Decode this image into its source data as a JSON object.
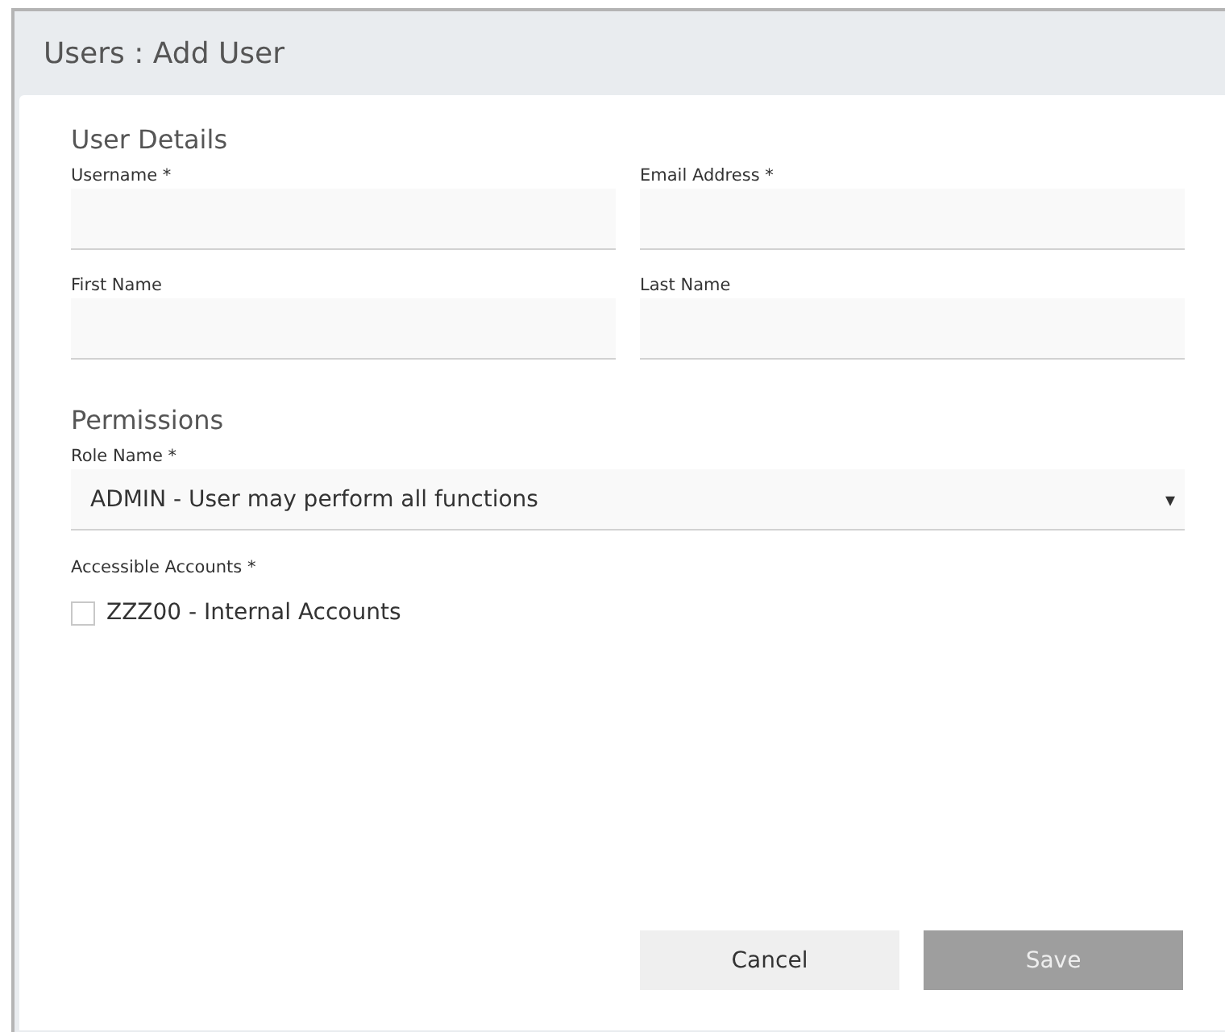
{
  "window": {
    "title": "Users : Add User"
  },
  "sections": [
    {
      "title": "User Details",
      "fields": [
        {
          "label": "Username *"
        },
        {
          "label": "Email Address *"
        },
        {
          "label": "First Name"
        },
        {
          "label": "Last Name"
        }
      ]
    },
    {
      "title": "Permissions"
    }
  ],
  "role": {
    "label": "Role Name *",
    "value": "ADMIN - User may perform all functions",
    "arrow": "▾"
  },
  "accounts": {
    "label": "Accessible Accounts *",
    "items": [
      {
        "label": "ZZZ00 - Internal Accounts",
        "checked": false
      }
    ]
  },
  "buttons": [
    {
      "label": "Cancel",
      "kind": "secondary",
      "disabled": false
    },
    {
      "label": "Save",
      "kind": "primary",
      "disabled": true
    }
  ]
}
